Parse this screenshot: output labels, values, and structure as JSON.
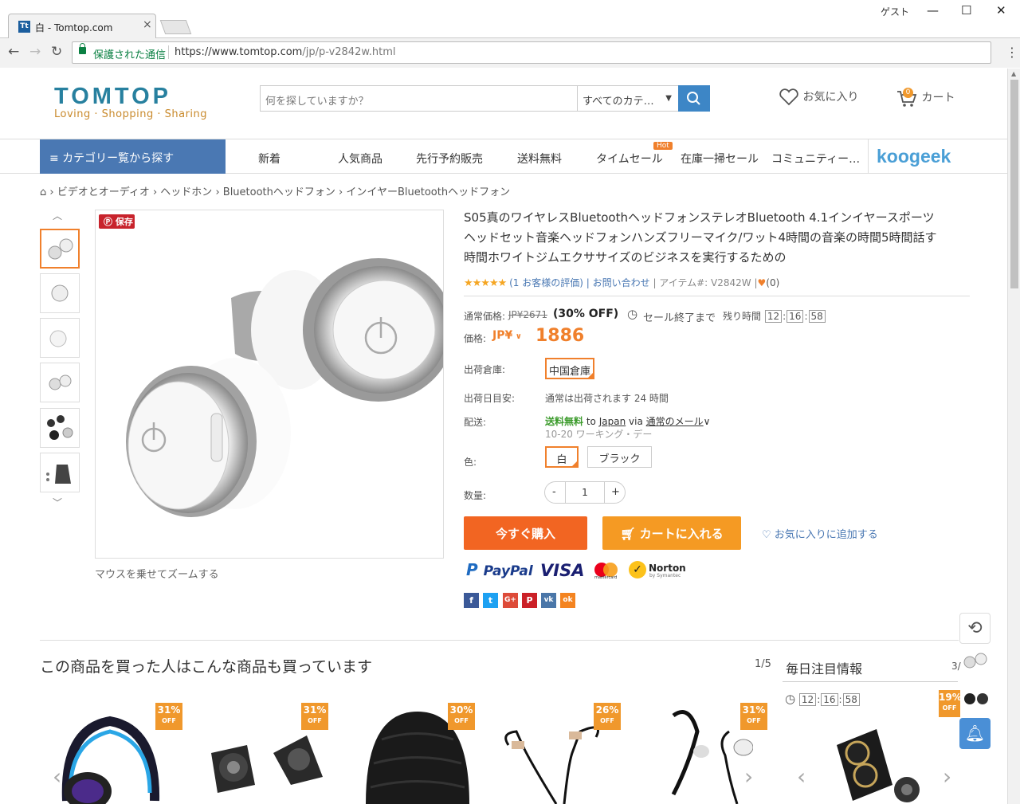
{
  "browser": {
    "tab_title": "白 - Tomtop.com",
    "tab_favicon": "Tt",
    "profile": "ゲスト",
    "secure_label": "保護された通信",
    "url_host": "https://www.tomtop.com",
    "url_path": "/jp/p-v2842w.html"
  },
  "header": {
    "logo": "TOMTOP",
    "tagline": "Loving · Shopping · Sharing",
    "search_placeholder": "何を探していますか？",
    "search_category": "すべてのカテ…",
    "wishlist_label": "お気に入り",
    "cart_label": "カート",
    "cart_count": "0"
  },
  "nav": {
    "category_button": "≡ カテゴリー覧から探す",
    "items": [
      "新着",
      "人気商品",
      "先行予約販売",
      "送料無料",
      "タイムセール",
      "在庫一掃セール",
      "コミュニティー…"
    ],
    "hot_badge": "Hot",
    "brand": "koogeek"
  },
  "breadcrumb": [
    "ビデオとオーディオ",
    "ヘッドホン",
    "Bluetoothヘッドフォン",
    "インイヤーBluetoothヘッドフォン"
  ],
  "gallery": {
    "save_label": "保存",
    "zoom_hint": "マウスを乗せてズームする"
  },
  "product": {
    "title": "S05真のワイヤレスBluetoothヘッドフォンステレオBluetooth 4.1インイヤースポーツヘッドセット音楽ヘッドフォンハンズフリーマイク/ワット4時間の音楽の時間5時間話す時間ホワイトジムエクササイズのビジネスを実行するための",
    "stars": "★★★★★",
    "reviews": "(1 お客様の評価)",
    "contact": "| お問い合わせ",
    "item_no": "| アイテム#: V2842W",
    "likes": "(0)",
    "regular_label": "通常価格:",
    "regular_price": "JP¥2671",
    "discount": "(30% OFF)",
    "sale_end_label": "セール終了まで",
    "remaining_label": "残り時間",
    "timer": [
      "12",
      "16",
      "58"
    ],
    "price_label": "価格:",
    "currency": "JP¥",
    "price": "1886",
    "warehouse_label": "出荷倉庫:",
    "warehouse": "中国倉庫",
    "ship_eta_label": "出荷日目安:",
    "ship_eta": "通常は出荷されます 24 時間",
    "delivery_label": "配送:",
    "free_shipping": "送料無料",
    "to": "to",
    "destination": "Japan",
    "via": "via",
    "method": "通常のメール",
    "business_days": "10-20 ワーキング・デー",
    "color_label": "色:",
    "colors": [
      "白",
      "ブラック"
    ],
    "qty_label": "数量:",
    "qty": "1",
    "qty_minus": "-",
    "qty_plus": "+",
    "buy_now": "今すぐ購入",
    "add_to_cart": "カートに入れる",
    "add_wishlist": "お気に入りに追加する"
  },
  "payments": {
    "paypal": "PayPal",
    "visa": "VISA",
    "mastercard": "mastercard",
    "norton": "Norton",
    "norton_sub": "by Symantec"
  },
  "social": [
    "f",
    "t",
    "G+",
    "P",
    "vk",
    "ok"
  ],
  "also_bought": {
    "title": "この商品を買った人はこんな商品も買っています",
    "pager": "1/5",
    "badges": [
      "31%",
      "31%",
      "30%",
      "26%",
      "31%"
    ],
    "off": "OFF"
  },
  "daily": {
    "title": "毎日注目情報",
    "pager": "3/",
    "timer": [
      "12",
      "16",
      "58"
    ],
    "badge": "19%",
    "off": "OFF"
  },
  "colors": {
    "accent_orange": "#f0802c",
    "nav_blue": "#4a78b3",
    "price_orange": "#f0802c",
    "free_green": "#3a9a2a"
  }
}
